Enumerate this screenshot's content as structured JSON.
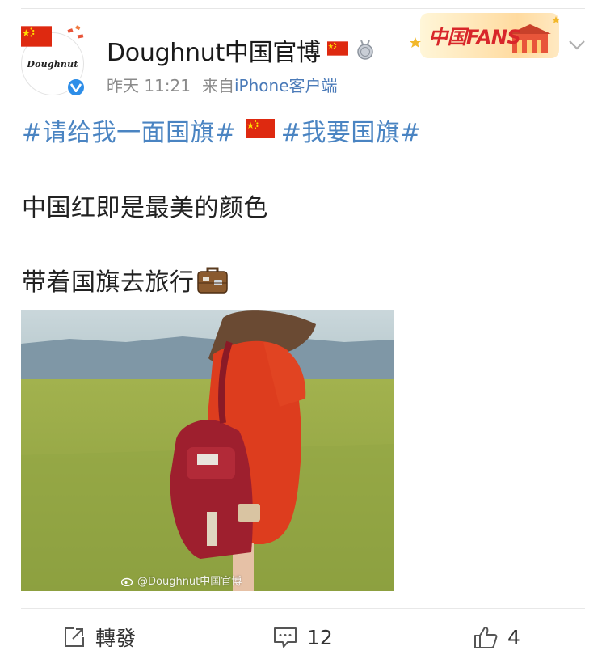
{
  "post": {
    "author": {
      "username": "Doughnut中国官博",
      "avatar_logo_text": "Doughnut",
      "verified": true
    },
    "meta": {
      "time": "昨天 11:21",
      "source_prefix": "来自",
      "source_name": "iPhone客户端"
    },
    "badge": {
      "text": "中国FANS"
    },
    "body": {
      "topic_1": "#请给我一面国旗#",
      "topic_2": "#我要国旗#",
      "line_2": "中国红即是最美的颜色",
      "line_3": "带着国旗去旅行"
    },
    "image": {
      "watermark": "@Doughnut中国官博"
    }
  },
  "actions": {
    "repost_label": "轉發",
    "comment_count": "12",
    "like_count": "4"
  },
  "colors": {
    "topic_blue": "#4a84c2",
    "verified_blue": "#2e8ee8",
    "flag_red": "#de2910",
    "flag_yellow": "#ffde00",
    "meta_gray": "#8a8a8a"
  },
  "icons": [
    "china-flag-icon",
    "medal-icon",
    "verified-icon",
    "chevron-down-icon",
    "suitcase-icon",
    "repost-icon",
    "comment-icon",
    "like-icon",
    "weibo-icon"
  ]
}
